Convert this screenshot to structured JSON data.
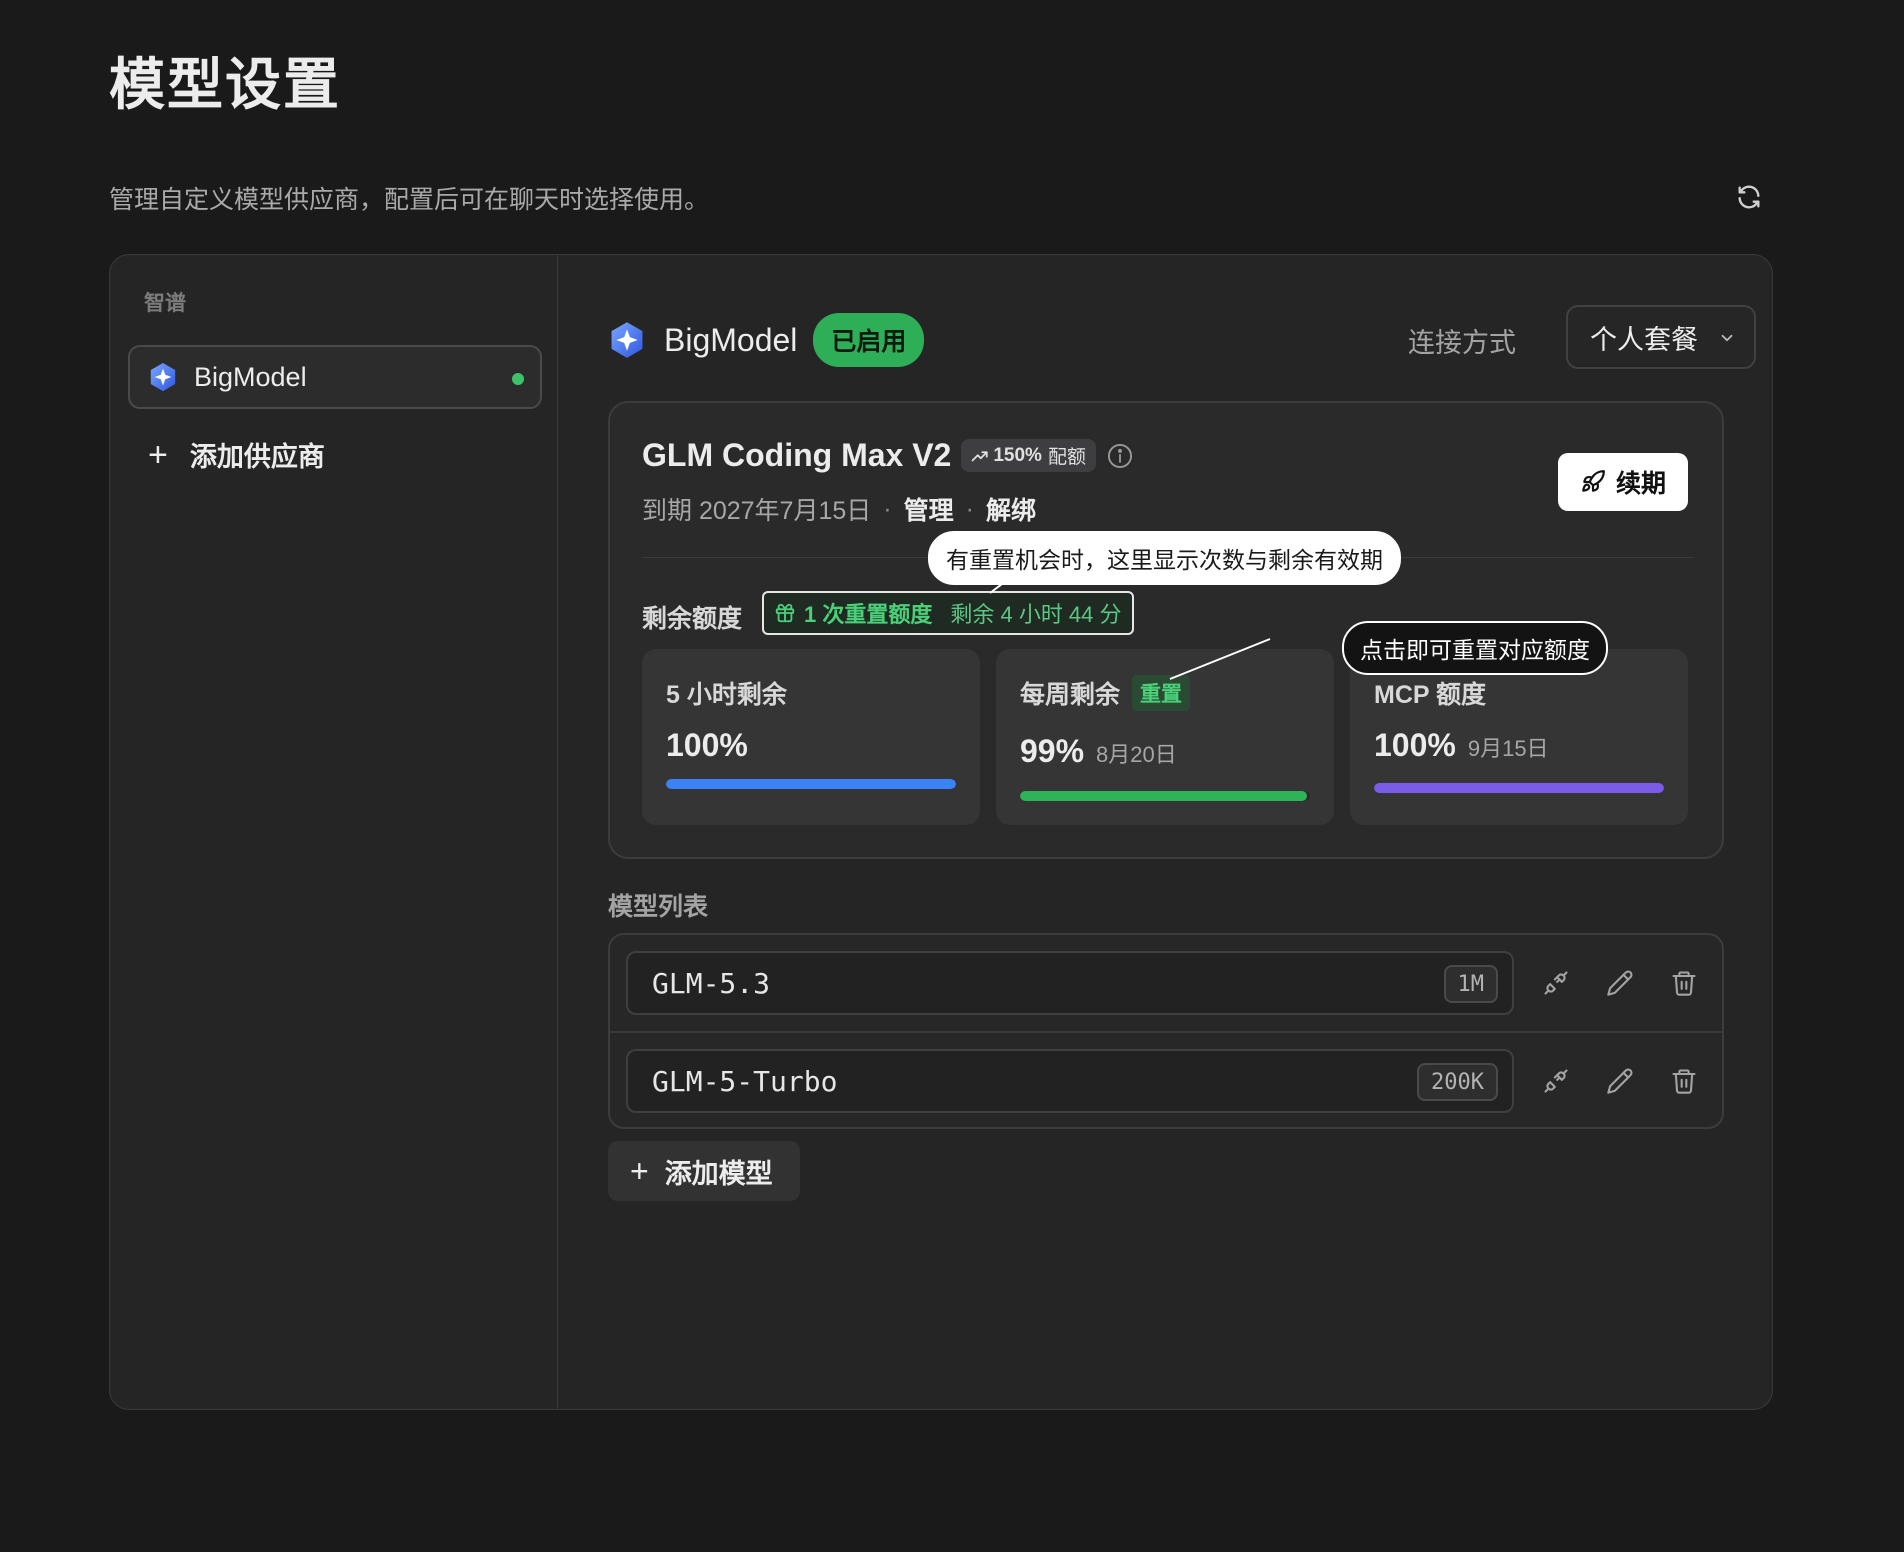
{
  "page": {
    "title": "模型设置",
    "description": "管理自定义模型供应商，配置后可在聊天时选择使用。"
  },
  "sidebar": {
    "group_label": "智谱",
    "providers": [
      {
        "label": "BigModel",
        "status": "active"
      }
    ],
    "add_provider_label": "添加供应商"
  },
  "provider": {
    "name": "BigModel",
    "status_badge": "已启用",
    "connection_label": "连接方式",
    "connection_value": "个人套餐"
  },
  "plan": {
    "title": "GLM Coding Max V2",
    "quota_badge_pct": "150%",
    "quota_badge_text": "配额",
    "expiry": "到期 2027年7月15日",
    "manage_link": "管理",
    "unbind_link": "解绑",
    "separator": "·",
    "renew_button": "续期",
    "remaining_label": "剩余额度",
    "reset_chip": "1 次重置额度",
    "reset_time_left": "剩余 4 小时 44 分",
    "usage": [
      {
        "title": "5 小时剩余",
        "value": "100%",
        "fraction": 1.0,
        "date": "",
        "color": "#3b82f6"
      },
      {
        "title": "每周剩余",
        "reset_tag": "重置",
        "value": "99%",
        "fraction": 0.99,
        "date": "8月20日",
        "color": "#2fb359"
      },
      {
        "title": "MCP 额度",
        "value": "100%",
        "fraction": 1.0,
        "date": "9月15日",
        "color": "#7b5ce8"
      }
    ]
  },
  "tooltips": {
    "reset_info": "有重置机会时，这里显示次数与剩余有效期",
    "reset_click": "点击即可重置对应额度"
  },
  "models": {
    "section_label": "模型列表",
    "items": [
      {
        "name": "GLM-5.3",
        "context": "1M"
      },
      {
        "name": "GLM-5-Turbo",
        "context": "200K"
      }
    ],
    "add_label": "添加模型"
  },
  "colors": {
    "enabled": "#2fae58",
    "accent_green": "#4bd07a",
    "bar_blue": "#3b82f6",
    "bar_green": "#2fb359",
    "bar_purple": "#7b5ce8"
  }
}
